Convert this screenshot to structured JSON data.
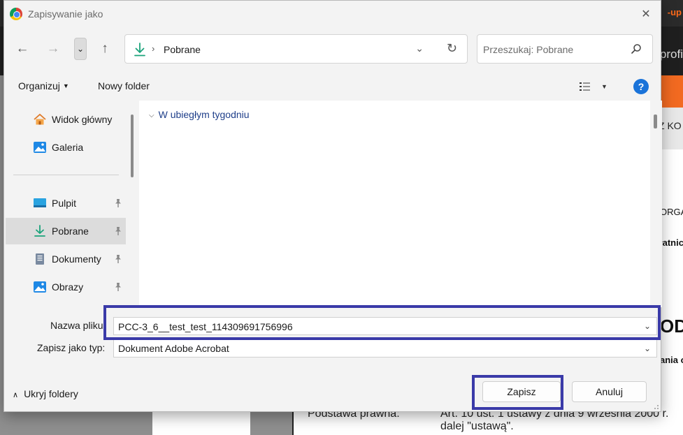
{
  "background": {
    "top_tag": "-up",
    "bar_text": "profi",
    "grey_text": "Z KO",
    "doc_lines": [
      "ORGA",
      "łatnic",
      "OD",
      "ania o"
    ],
    "bottom_left": "Podstawa prawna:",
    "bottom_right_1": "Art. 10 ust. 1 ustawy z dnia 9 września 2000 r.",
    "bottom_right_2": "dalej \"ustawą\"."
  },
  "dialog": {
    "title": "Zapisywanie jako",
    "close_glyph": "✕"
  },
  "address_bar": {
    "back_glyph": "←",
    "forward_glyph": "→",
    "recent_glyph": "⌄",
    "up_glyph": "↑",
    "separator": "›",
    "crumb": "Pobrane",
    "dropdown_glyph": "⌄",
    "refresh_glyph": "↻"
  },
  "search": {
    "placeholder": "Przeszukaj: Pobrane"
  },
  "toolbar": {
    "organize_label": "Organizuj",
    "organize_caret": "▼",
    "new_folder_label": "Nowy folder",
    "view_caret": "▼",
    "help_glyph": "?"
  },
  "nav_pane": {
    "items": [
      {
        "label": "Widok główny",
        "icon": "home-icon"
      },
      {
        "label": "Galeria",
        "icon": "gallery-icon"
      },
      {
        "label": "Pulpit",
        "icon": "desktop-icon",
        "pinned": true
      },
      {
        "label": "Pobrane",
        "icon": "download-icon",
        "pinned": true,
        "selected": true
      },
      {
        "label": "Dokumenty",
        "icon": "documents-icon",
        "pinned": true
      },
      {
        "label": "Obrazy",
        "icon": "pictures-icon",
        "pinned": true
      }
    ]
  },
  "files_pane": {
    "group_chevron": "⌵",
    "group_header": "W ubiegłym tygodniu"
  },
  "form": {
    "file_name_label": "Nazwa pliku:",
    "file_name_value": "PCC-3_6__test_test_114309691756996",
    "file_type_label": "Zapisz jako typ:",
    "file_type_value": "Dokument Adobe Acrobat",
    "dropdown_glyph": "⌄"
  },
  "footer": {
    "hide_folders_chevron": "∧",
    "hide_folders_label": "Ukryj foldery",
    "save_label": "Zapisz",
    "cancel_label": "Anuluj"
  },
  "colors": {
    "highlight": "#3a3aa8",
    "accent_blue": "#1a73d9",
    "download_green": "#1aa37a",
    "background_orange": "#f26a21"
  }
}
